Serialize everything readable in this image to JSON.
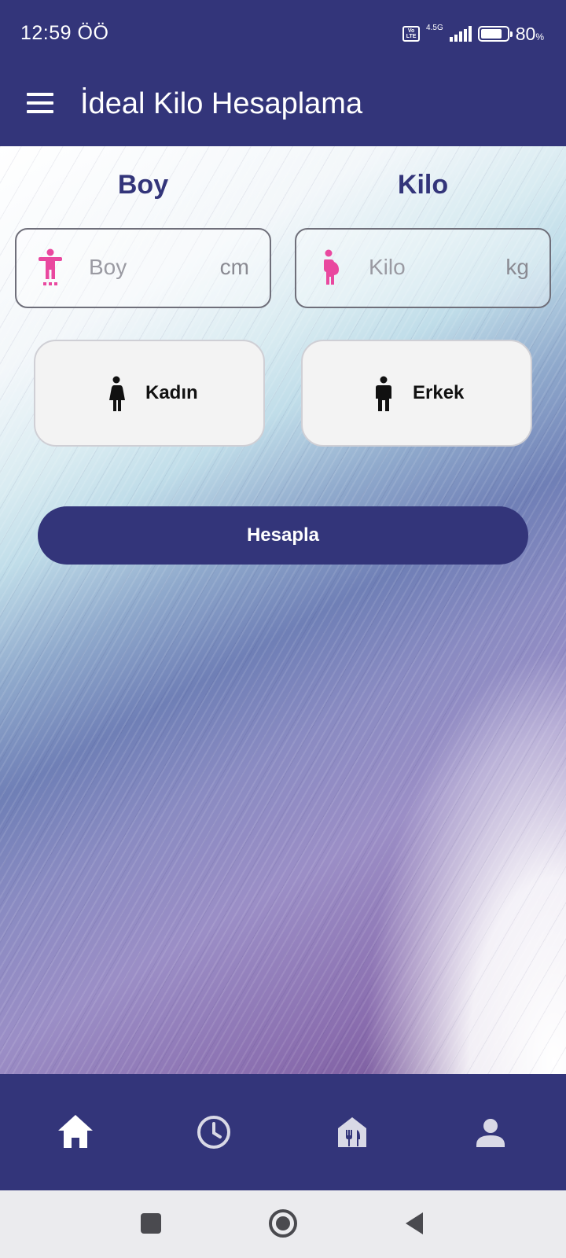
{
  "status_bar": {
    "time": "12:59 ÖÖ",
    "volte_label": "Vo LTE",
    "network_type": "4.5G",
    "battery_percent": "80",
    "battery_percent_sign": "%",
    "battery_level": 0.8
  },
  "app_bar": {
    "title": "İdeal Kilo Hesaplama",
    "menu_icon": "hamburger-menu-icon"
  },
  "form": {
    "height_heading": "Boy",
    "weight_heading": "Kilo",
    "height_input": {
      "placeholder": "Boy",
      "unit": "cm",
      "value": "",
      "icon": "height-person-icon",
      "icon_color": "#e9489f"
    },
    "weight_input": {
      "placeholder": "Kilo",
      "unit": "kg",
      "value": "",
      "icon": "pregnant-person-icon",
      "icon_color": "#e9489f"
    },
    "gender_female": {
      "label": "Kadın",
      "icon": "woman-icon"
    },
    "gender_male": {
      "label": "Erkek",
      "icon": "man-icon"
    },
    "calculate_button": "Hesapla"
  },
  "bottom_nav": {
    "items": [
      {
        "name": "home",
        "icon": "home-icon",
        "active": true
      },
      {
        "name": "history",
        "icon": "clock-icon",
        "active": false
      },
      {
        "name": "diet",
        "icon": "restaurant-icon",
        "active": false
      },
      {
        "name": "profile",
        "icon": "person-icon",
        "active": false
      }
    ]
  },
  "system_nav": {
    "buttons": [
      "recents-square-icon",
      "home-circle-icon",
      "back-triangle-icon"
    ]
  },
  "colors": {
    "primary": "#33357a",
    "accent_pink": "#e9489f",
    "nav_inactive": "#d9d9e6",
    "nav_active": "#ffffff"
  }
}
